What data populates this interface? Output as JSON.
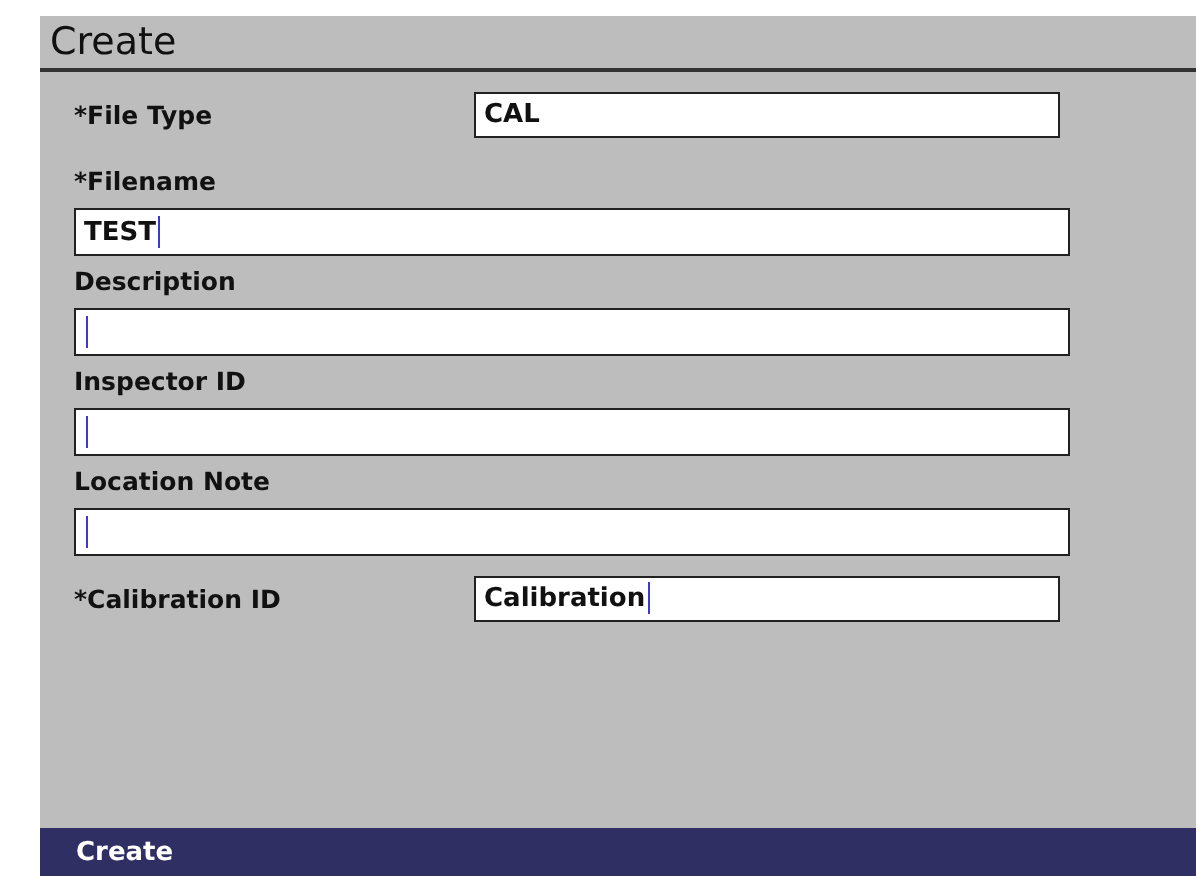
{
  "window": {
    "title": "Create"
  },
  "fields": [
    {
      "kind": "inline",
      "label": "*File Type",
      "value": "CAL",
      "cursor": false
    },
    {
      "kind": "stacked",
      "label": "*Filename",
      "value": "TEST",
      "cursor": true
    },
    {
      "kind": "stacked",
      "label": "Description",
      "cursor": true
    },
    {
      "kind": "stacked",
      "label": "Inspector ID",
      "cursor": true
    },
    {
      "kind": "stacked",
      "label": "Location Note",
      "cursor": true
    },
    {
      "kind": "inline",
      "label": "*Calibration ID",
      "value": "Calibration",
      "cursor": true
    }
  ],
  "footer": {
    "label": "Create"
  }
}
